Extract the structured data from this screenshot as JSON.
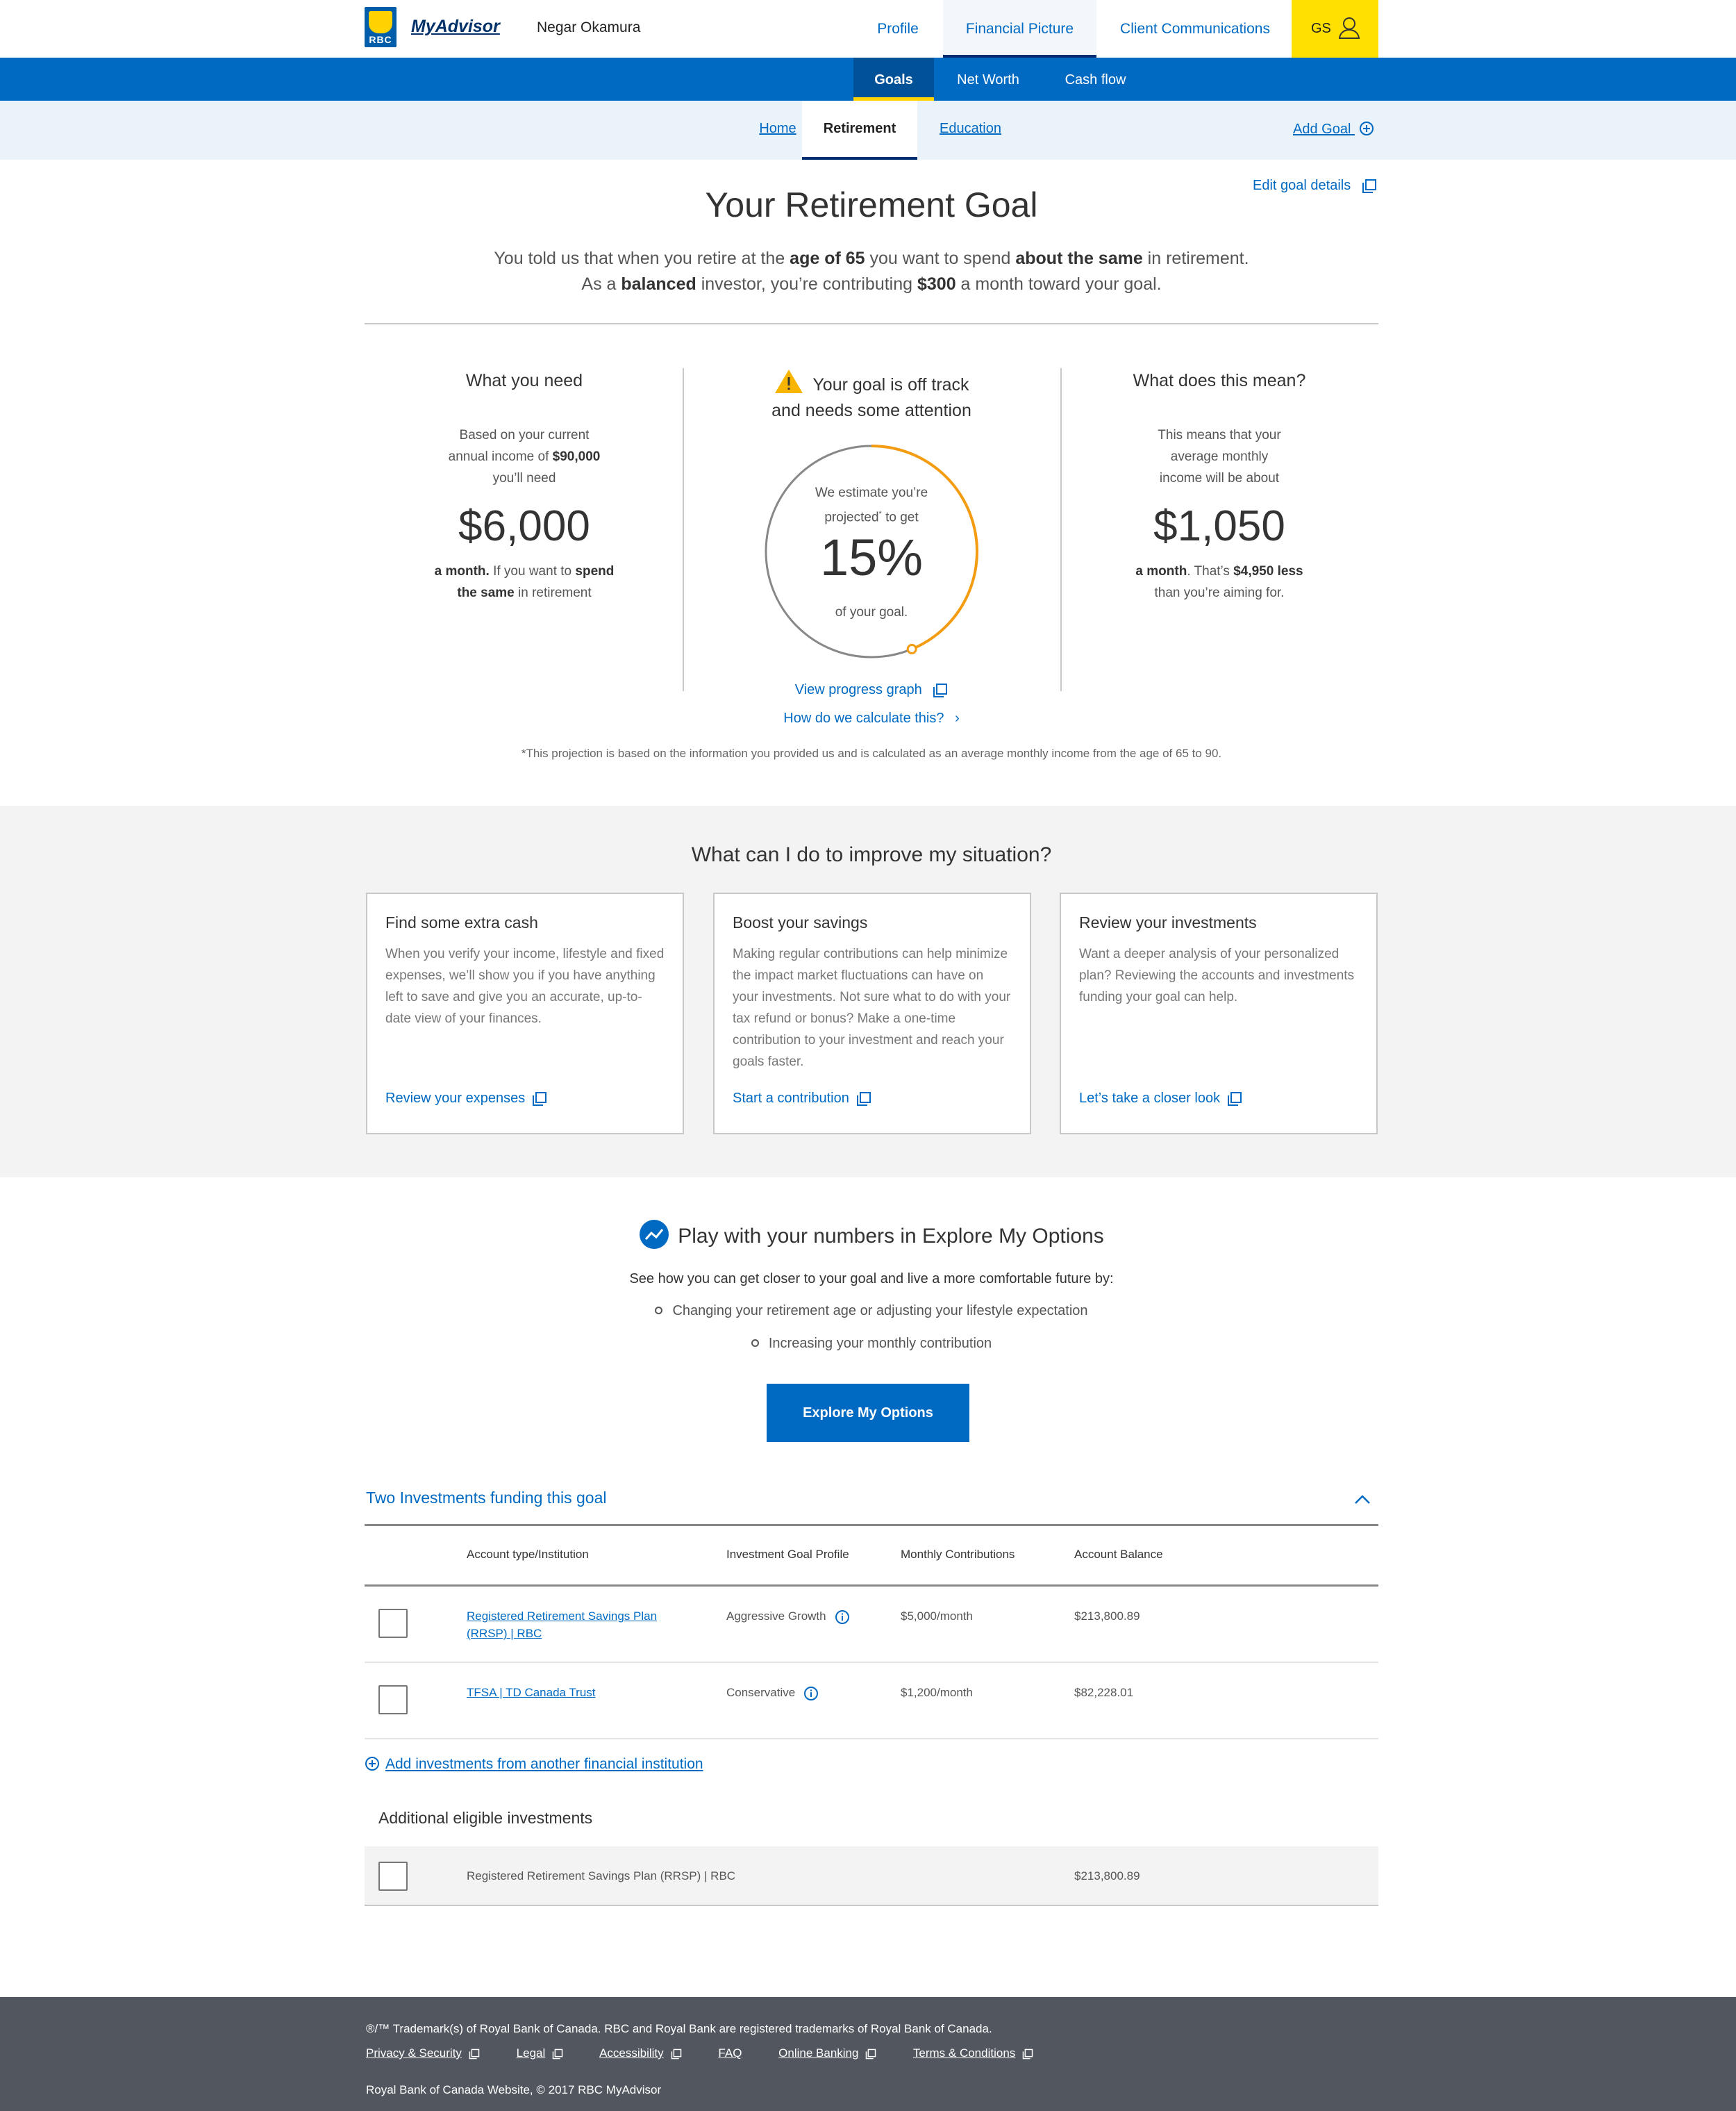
{
  "header": {
    "brand": "MyAdvisor",
    "logo_text": "RBC",
    "user_name": "Negar Okamura",
    "nav": [
      "Profile",
      "Financial Picture",
      "Client Communications"
    ],
    "initials": "GS"
  },
  "subnav": [
    "Goals",
    "Net Worth",
    "Cash flow"
  ],
  "goal_tabs": [
    "Home",
    "Retirement",
    "Education"
  ],
  "add_goal": "Add Goal",
  "edit_goal": "Edit goal details",
  "title": "Your Retirement Goal",
  "intro": {
    "l1a": "You told us that when you retire at the ",
    "l1b": "age of 65",
    "l1c": " you want to spend ",
    "l1d": "about the same",
    "l1e": " in retirement.",
    "l2a": "As a ",
    "l2b": "balanced",
    "l2c": " investor, you’re contributing ",
    "l2d": "$300",
    "l2e": " a month toward your goal."
  },
  "need": {
    "title": "What you need",
    "d1": "Based on your current",
    "d2a": "annual income of ",
    "d2b": "$90,000",
    "d3": "you’ll need",
    "amount": "$6,000",
    "f1a": "a month.",
    "f1b": " If you want to ",
    "f1c": "spend",
    "f2a": "the same",
    "f2b": " in retirement"
  },
  "status": {
    "l1": "Your goal is off track",
    "l2": "and needs some attention",
    "e1": "We estimate you’re",
    "e2": "projected",
    "star": "*",
    "e3": " to get",
    "percent": "15%",
    "progress": 0.15,
    "e4": "of your goal.",
    "graph_link": "View progress graph",
    "calc_link": "How do we calculate this?",
    "chevron": "›"
  },
  "meaning": {
    "title": "What does this mean?",
    "d1": "This means that your",
    "d2": "average monthly",
    "d3": "income will be about",
    "amount": "$1,050",
    "f1a": "a month",
    "f1b": ". That’s ",
    "f1c": "$4,950 less",
    "f2": "than you’re aiming for."
  },
  "footnote": "*This projection is based on the information you provided us and is calculated as an average monthly income from the age of 65 to 90.",
  "improve": {
    "title": "What can I do to improve my situation?",
    "cards": [
      {
        "title": "Find some extra cash",
        "body": "When you verify your income, lifestyle and fixed expenses, we’ll show you if you have anything left to save and give you an accurate, up-to-date view of your finances.",
        "link": "Review your expenses"
      },
      {
        "title": "Boost your savings",
        "body": "Making regular contributions can help minimize the impact market fluctuations can have on your investments. Not sure what to do with your tax refund or bonus? Make a one-time contribution to your investment and reach your goals faster.",
        "link": "Start a contribution"
      },
      {
        "title": "Review your investments",
        "body": "Want a deeper analysis of your personalized plan? Reviewing the accounts and investments funding your goal can help.",
        "link": "Let’s take a closer look"
      }
    ]
  },
  "explore": {
    "title": "Play with your numbers in Explore My Options",
    "lead": "See how you can get closer to your goal and live a more comfortable future by:",
    "b1": "Changing your retirement age or adjusting your lifestyle expectation",
    "b2": "Increasing your monthly contribution",
    "button": "Explore My Options"
  },
  "investments": {
    "title": "Two Investments funding this goal",
    "headers": [
      "Account type/Institution",
      "Investment Goal Profile",
      "Monthly Contributions",
      "Account Balance"
    ],
    "rows": [
      {
        "account_l1": "Registered Retirement Savings Plan",
        "account_l2": "(RRSP) | RBC",
        "profile": "Aggressive Growth",
        "monthly": "$5,000/month",
        "balance": "$213,800.89"
      },
      {
        "account_l1": "TFSA | TD Canada Trust",
        "account_l2": "",
        "profile": "Conservative",
        "monthly": "$1,200/month",
        "balance": "$82,228.01"
      }
    ],
    "add_link": "Add investments from another financial institution",
    "additional_title": "Additional eligible investments",
    "additional": {
      "account": "Registered Retirement Savings Plan (RRSP) | RBC",
      "balance": "$213,800.89"
    }
  },
  "footer": {
    "trademark": "®/™ Trademark(s) of Royal Bank of Canada. RBC and Royal Bank are registered trademarks of Royal Bank of Canada.",
    "links": [
      "Privacy & Security",
      "Legal",
      "Accessibility",
      "FAQ",
      "Online Banking",
      "Terms & Conditions"
    ],
    "copyright": "Royal Bank of Canada Website, © 2017 RBC MyAdvisor"
  },
  "colors": {
    "primary": "#006ac3",
    "accent_yellow": "#ffd200",
    "progress_orange": "#f39c12",
    "footer_bg": "#52565f"
  }
}
